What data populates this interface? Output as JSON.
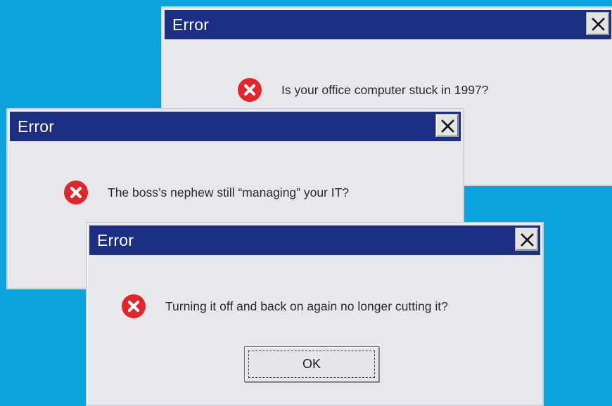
{
  "desktop": {
    "background_color": "#0aa3dc"
  },
  "theme": {
    "titlebar_color": "#1c2f82",
    "dialog_color": "#e8e8ea",
    "error_icon_color": "#e0252b"
  },
  "dialogs": [
    {
      "title": "Error",
      "message": "Is your office computer stuck in 1997?",
      "icon": "error-icon",
      "close_icon": "close-icon"
    },
    {
      "title": "Error",
      "message": "The boss’s nephew still “managing” your IT?",
      "icon": "error-icon",
      "close_icon": "close-icon"
    },
    {
      "title": "Error",
      "message": "Turning it off and back on again no longer cutting it?",
      "icon": "error-icon",
      "close_icon": "close-icon",
      "ok_label": "OK"
    }
  ]
}
